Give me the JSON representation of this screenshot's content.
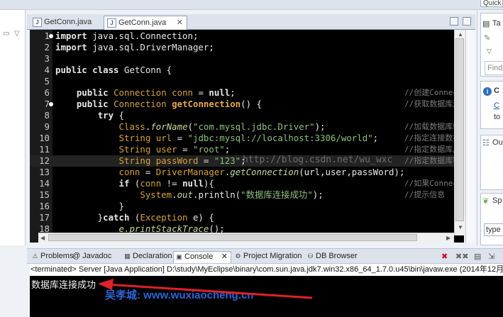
{
  "search": {
    "placeholder": "Quick"
  },
  "editor": {
    "tabs": [
      {
        "label": "GetConn.java",
        "active": false
      },
      {
        "label": "GetConn.java",
        "active": true
      }
    ],
    "lines": [
      {
        "n": "1",
        "html": "<span class=\"kw\">import</span> java.sql.Connection;",
        "comment": ""
      },
      {
        "n": "2",
        "html": "<span class=\"kw\">import</span> java.sql.DriverManager;",
        "comment": ""
      },
      {
        "n": "3",
        "html": "",
        "comment": ""
      },
      {
        "n": "4",
        "html": "<span class=\"kw\">public class</span> GetConn {",
        "comment": ""
      },
      {
        "n": "5",
        "html": "",
        "comment": ""
      },
      {
        "n": "6",
        "html": "    <span class=\"kw\">public</span> <span class=\"ty\">Connection</span> <span class=\"fld\">conn</span> = <span class=\"kw\">null</span>;",
        "comment": "//创建Connection"
      },
      {
        "n": "7",
        "html": "    <span class=\"kw\">public</span> <span class=\"ty\">Connection</span> <span class=\"mth\"><b>getConnection</b></span>() {",
        "comment": "//获取数据库连接"
      },
      {
        "n": "8",
        "html": "        <span class=\"kw\">try</span> {",
        "comment": ""
      },
      {
        "n": "9",
        "html": "            <span class=\"ty\">Class</span>.<span class=\"ital\">forName</span>(<span class=\"str\">\"com.mysql.jdbc.Driver\"</span>);",
        "comment": "//加载数据库驱动"
      },
      {
        "n": "10",
        "html": "            <span class=\"ty\">String</span> <span class=\"ty\">url</span> = <span class=\"str\">\"jdbc:mysql://localhost:3306/world\"</span>;",
        "comment": "//指定连接数据库"
      },
      {
        "n": "11",
        "html": "            <span class=\"ty\">String</span> <span class=\"ty\">user</span> = <span class=\"str\">\"root\"</span>;",
        "comment": "//指定数据库用户"
      },
      {
        "n": "12",
        "html": "            <span class=\"ty\">String</span> <span class=\"ty\">passWord</span> = <span class=\"str\">\"123\"</span>;",
        "comment": "//指定数据库密码"
      },
      {
        "n": "13",
        "html": "            <span class=\"ty\">conn</span> = <span class=\"ty\">DriverManager</span>.<span class=\"ital\">getConnection</span>(url,user,passWord);",
        "comment": ""
      },
      {
        "n": "14",
        "html": "            <span class=\"kw\">if</span> (<span class=\"ty\">conn</span> != <span class=\"kw\">null</span>){",
        "comment": "//如果Connection"
      },
      {
        "n": "15",
        "html": "                <span class=\"ty\">System</span>.<span class=\"ital\">out</span>.println(<span class=\"str\">\"数据库连接成功\"</span>);",
        "comment": "//提示信息"
      },
      {
        "n": "16",
        "html": "            }",
        "comment": ""
      },
      {
        "n": "17",
        "html": "        }<span class=\"kw\">catch</span> (<span class=\"ty\">Exception</span> e) {",
        "comment": ""
      },
      {
        "n": "18",
        "html": "            <span class=\"ital\">e.printStackTrace</span>();",
        "comment": ""
      }
    ],
    "watermark": "http://blog.csdn.net/wu_wxc"
  },
  "right_panel": {
    "task_label": "Ta",
    "find_placeholder": "Find",
    "connect_label": "C",
    "connect_link": "C",
    "connect_to": "to",
    "outline_label": "Ou",
    "sp_label": "Sp",
    "type_label": "type"
  },
  "console": {
    "tabs": [
      {
        "label": "Problems",
        "icon": "!"
      },
      {
        "label": "@ Javadoc",
        "icon": ""
      },
      {
        "label": "Declaration",
        "icon": "D"
      },
      {
        "label": "Console",
        "icon": "C",
        "active": true
      },
      {
        "label": "Project Migration",
        "icon": "P"
      },
      {
        "label": "DB Browser",
        "icon": "B"
      }
    ],
    "status": "<terminated> Server [Java Application] D:\\study\\MyEclipse\\binary\\com.sun.java.jdk7.win32.x86_64_1.7.0.u45\\bin\\javaw.exe (2014年12月",
    "output": "数据库连接成功",
    "watermark": "吴孝城: www.wuxiaocheng.cn"
  },
  "colors": {
    "arrow": "#e0202a",
    "watermark_blue": "#2a66d6"
  }
}
